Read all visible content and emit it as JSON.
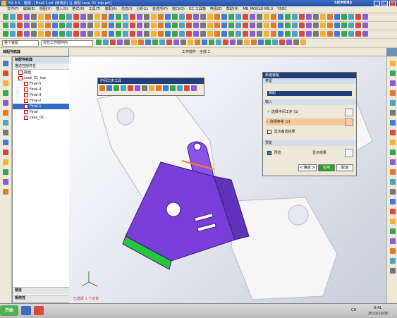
{
  "window": {
    "title": "NX 8.5 - 建模 - [Final-1.prt (修改的) 在 装配 case_01_top.prt]",
    "brand": "SIEMENS"
  },
  "menubar": {
    "items": [
      "文件(F)",
      "编辑(E)",
      "视图(V)",
      "插入(S)",
      "格式(R)",
      "工具(T)",
      "装配(A)",
      "信息(I)",
      "分析(L)",
      "首选项(P)",
      "窗口(O)",
      "GC 工具箱",
      "电极(E)",
      "帮助(H)",
      "MB_MOULD M8.0",
      "YSOC"
    ]
  },
  "toolbar3": {
    "filter_label": "整个装配",
    "scope_label": "仅在工作部件内"
  },
  "navigator": {
    "title": "装配导航器",
    "column_header": "描述性部件名",
    "tree": [
      {
        "label": "截面",
        "indent": 1,
        "selected": false
      },
      {
        "label": "case_01_top",
        "indent": 1,
        "selected": false
      },
      {
        "label": "Final-5",
        "indent": 2,
        "selected": false
      },
      {
        "label": "Final-4",
        "indent": 2,
        "selected": false
      },
      {
        "label": "Final-3",
        "indent": 2,
        "selected": false
      },
      {
        "label": "Final-2",
        "indent": 2,
        "selected": false
      },
      {
        "label": "Final-1",
        "indent": 2,
        "selected": true
      },
      {
        "label": "Final",
        "indent": 2,
        "selected": false
      },
      {
        "label": "case_01",
        "indent": 2,
        "selected": false
      }
    ],
    "bottom": [
      "预览",
      "相依性"
    ]
  },
  "work_status": "工作部件 - 全部 1",
  "mid_toolbar": {
    "title": "中间工步工具"
  },
  "dialog": {
    "title": "新建装配",
    "type_section": "类型",
    "type_value": "装配",
    "input_section": "输入",
    "row1": "选择中间工步 (1)",
    "row2": "选择参考 (2)",
    "row3": "显示备选结果",
    "settings_section": "预览",
    "preview_label": "预览",
    "show_result_label": "显示结果",
    "ok": "< 确定 >",
    "apply": "应用",
    "cancel": "取消"
  },
  "status_bar": "已选择 1 个对象",
  "taskbar": {
    "start": "开始",
    "time": "8:41",
    "date": "2013/10/30",
    "lang": "CH"
  },
  "colors": {
    "part_purple": "#7a3fd8",
    "part_green": "#22c83a",
    "ghost": "#f4f4f4",
    "title_blue": "#2450a8"
  }
}
